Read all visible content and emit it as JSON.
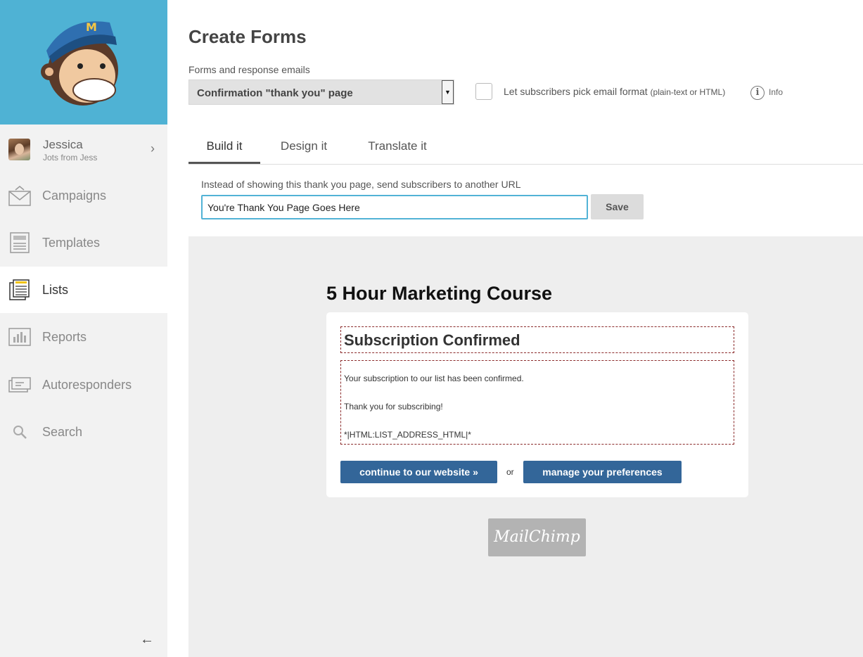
{
  "sidebar": {
    "user": {
      "name": "Jessica",
      "subtitle": "Jots from Jess",
      "chevron": "›"
    },
    "nav": [
      {
        "label": "Campaigns",
        "icon": "envelope-icon"
      },
      {
        "label": "Templates",
        "icon": "template-icon"
      },
      {
        "label": "Lists",
        "icon": "list-icon",
        "active": true
      },
      {
        "label": "Reports",
        "icon": "chart-icon"
      },
      {
        "label": "Autoresponders",
        "icon": "autoresponder-icon"
      },
      {
        "label": "Search",
        "icon": "search-icon"
      }
    ],
    "collapse_glyph": "←",
    "logo_bg": "#4fb2d4"
  },
  "main": {
    "title": "Create Forms",
    "forms_label": "Forms and response emails",
    "form_select": {
      "value": "Confirmation \"thank you\" page",
      "arrow": "▼"
    },
    "checkbox": {
      "label": "Let subscribers pick email format",
      "label_small": "(plain-text or HTML)",
      "checked": false
    },
    "info": {
      "glyph": "i",
      "label": "Info"
    },
    "tabs": [
      {
        "label": "Build it",
        "active": true
      },
      {
        "label": "Design it"
      },
      {
        "label": "Translate it"
      }
    ],
    "url_label": "Instead of showing this thank you page, send subscribers to another URL",
    "url_value": "You're Thank You Page Goes Here",
    "save_label": "Save"
  },
  "preview": {
    "title": "5 Hour Marketing Course",
    "heading": "Subscription Confirmed",
    "body_lines": [
      "Your subscription to our list has been confirmed.",
      "Thank you for subscribing!",
      "*|HTML:LIST_ADDRESS_HTML|*"
    ],
    "continue_label": "continue to our website »",
    "or_text": "or",
    "preferences_label": "manage your preferences",
    "badge_text": "MailChimp",
    "button_color": "#336699"
  }
}
